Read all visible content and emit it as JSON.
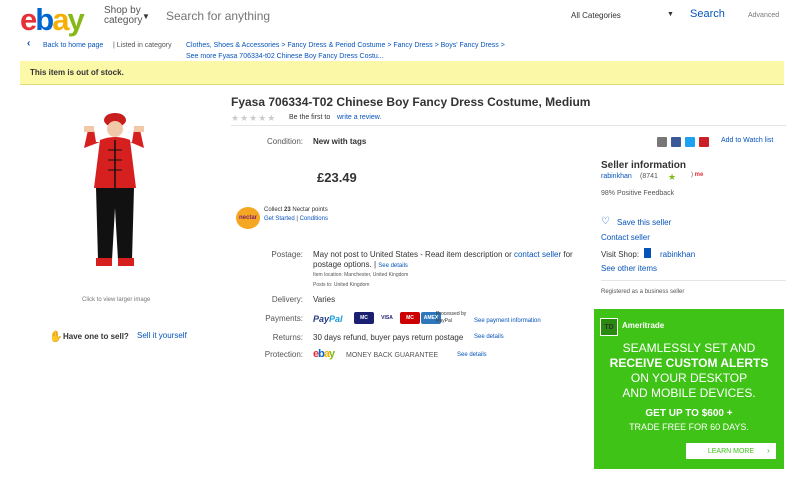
{
  "header": {
    "logo": [
      "e",
      "b",
      "a",
      "y"
    ],
    "shop_by_line1": "Shop by",
    "shop_by_line2": "category",
    "search_placeholder": "Search for anything",
    "category": "All Categories",
    "search_button": "Search",
    "advanced": "Advanced"
  },
  "breadcrumb": {
    "back": "Back to home page",
    "listed": "| Listed in category",
    "trail": "Clothes, Shoes & Accessories  >  Fancy Dress & Period Costume  >  Fancy Dress  >  Boys' Fancy Dress  >",
    "more": "See more Fyasa 706334-t02 Chinese Boy Fancy Dress Costu..."
  },
  "banner": "This item is out of stock.",
  "image": {
    "click_to_view": "Click to view larger image"
  },
  "sell": {
    "prompt": "Have one to sell?",
    "link": "Sell it yourself"
  },
  "item": {
    "title": "Fyasa 706334-T02 Chinese Boy Fancy Dress Costume, Medium",
    "stars": "★★★★★",
    "first_review": "Be the first to",
    "write_review": "write a review.",
    "condition_label": "Condition:",
    "condition_value": "New with tags",
    "price": "£23.49",
    "nectar_logo": "nectar",
    "nectar_collect_pre": "Collect ",
    "nectar_points": "23",
    "nectar_collect_post": " Nectar points",
    "nectar_get_started": "Get Started",
    "nectar_conditions": "Conditions",
    "postage_label": "Postage:",
    "postage_value_pre": "May not post to United States - Read item description or ",
    "postage_contact": "contact seller",
    "postage_value_post": " for postage options.",
    "postage_see_details": "See details",
    "item_location": "Item location:  Manchester, United Kingdom",
    "posts_to": "Posts to:  United Kingdom",
    "delivery_label": "Delivery:",
    "delivery_value": "Varies",
    "payments_label": "Payments:",
    "paypal_1": "Pay",
    "paypal_2": "Pal",
    "card_labels": [
      "MC",
      "VISA",
      "MC",
      "AMEX"
    ],
    "processed": "Processed by PayPal",
    "payment_details": "See payment information",
    "returns_label": "Returns:",
    "returns_value": "30 days refund, buyer pays return postage",
    "returns_details": "See details",
    "protection_label": "Protection:",
    "mbg": "MONEY BACK GUARANTEE",
    "protection_details": "See details"
  },
  "share": {
    "watch": "Add to Watch list",
    "colors": [
      "#777777",
      "#3b5998",
      "#1da1f2",
      "#cb2027"
    ]
  },
  "seller": {
    "heading": "Seller information",
    "name": "rabinkhan",
    "score": "(8741",
    "score_close": ")",
    "me_badge": "me",
    "feedback": "98% Positive Feedback",
    "save": "Save this seller",
    "contact": "Contact seller",
    "visit_label": "Visit Shop:",
    "shop_name": "rabinkhan",
    "other_items": "See other items",
    "business": "Registered as a business seller"
  },
  "ad": {
    "logo": "TD",
    "brand": "Ameritrade",
    "line1": "SEAMLESSLY SET AND",
    "line2": "RECEIVE CUSTOM ALERTS",
    "line3": "ON YOUR DESKTOP",
    "line4": "AND MOBILE DEVICES.",
    "line5": "GET UP TO $600 +",
    "line6": "TRADE FREE FOR 60 DAYS.",
    "cta": "LEARN MORE",
    "accent": "#3ec316"
  }
}
